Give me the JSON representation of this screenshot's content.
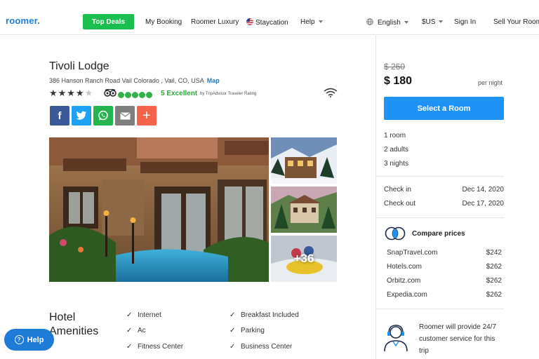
{
  "nav": {
    "logo": "roomer",
    "logo_dot": ".",
    "top_deals": "Top Deals",
    "my_booking": "My Booking",
    "roomer_luxury": "Roomer Luxury",
    "staycation": "Staycation",
    "help": "Help",
    "language": "English",
    "currency": "$US",
    "sign_in": "Sign In",
    "sell_room": "Sell Your Room"
  },
  "hotel": {
    "name": "Tivoli Lodge",
    "address": "386 Hanson Ranch Road Vail Colorado , Vail, CO, USA",
    "map_link": "Map",
    "stars_on": "★★★★",
    "stars_off": "★",
    "star_rating": 4,
    "rating_text": "5 Excellent",
    "rating_source": "by TripAdvisor Traveler Rating",
    "more_photos": "+36"
  },
  "share": {
    "facebook": "f",
    "email_color": "#7f7f7f",
    "plus": "+"
  },
  "amenities": {
    "title": "Hotel Amenities",
    "items": [
      "Internet",
      "Breakfast Included",
      "Ac",
      "Parking",
      "Fitness Center",
      "Business Center"
    ],
    "check": "✓"
  },
  "help_button": {
    "label": "Help",
    "icon": "?"
  },
  "booking": {
    "old_price": "$ 260",
    "price": "$ 180",
    "per_night": "per night",
    "select_room": "Select a Room",
    "rooms": "1 room",
    "adults": "2 adults",
    "nights": "3 nights",
    "check_in_label": "Check in",
    "check_in_date": "Dec 14, 2020",
    "check_out_label": "Check out",
    "check_out_date": "Dec 17, 2020"
  },
  "compare": {
    "title": "Compare prices",
    "providers": [
      {
        "name": "SnapTravel.com",
        "price": "$242"
      },
      {
        "name": "Hotels.com",
        "price": "$262"
      },
      {
        "name": "Orbitz.com",
        "price": "$262"
      },
      {
        "name": "Expedia.com",
        "price": "$262"
      }
    ]
  },
  "support": {
    "text": "Roomer will provide 24/7 customer service for this trip"
  },
  "colors": {
    "brand_blue": "#1e7bd6",
    "deals_green": "#1bbf50",
    "select_blue": "#1e93f5",
    "rating_green": "#34b04a",
    "facebook": "#3b5998",
    "twitter": "#1da1f2",
    "whatsapp": "#25b54e",
    "more_share": "#f4644a"
  }
}
